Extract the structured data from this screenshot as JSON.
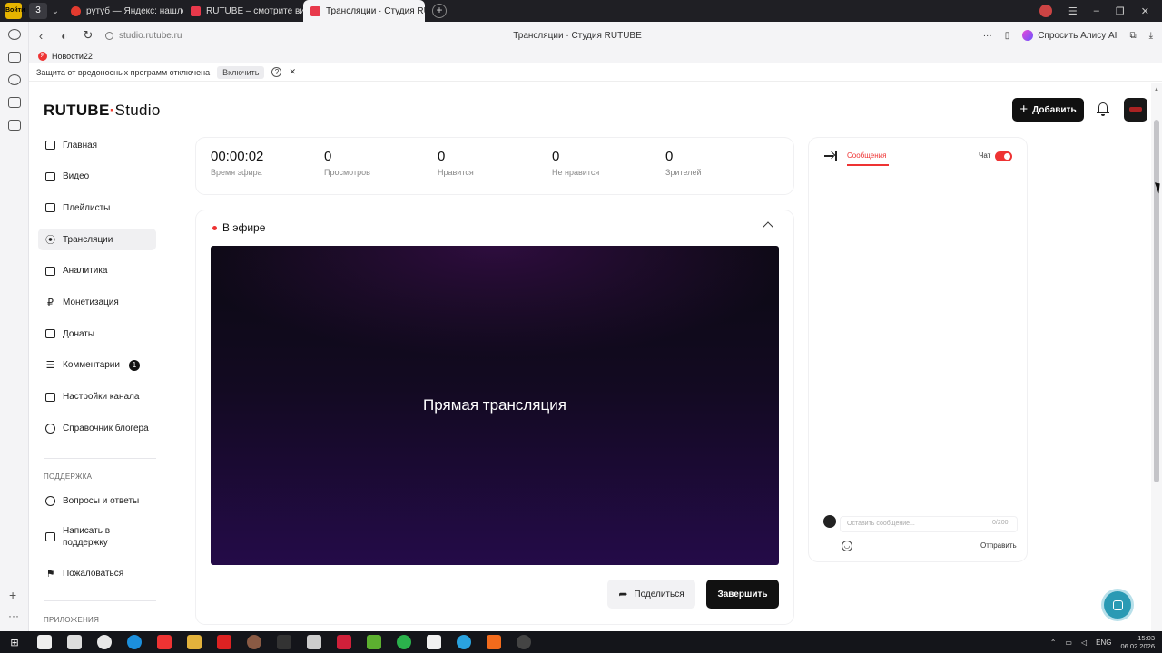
{
  "browser": {
    "tab_counter": "3",
    "logo_text": "Войти",
    "tabs": [
      {
        "label": "рутуб — Яндекс: нашлось",
        "color": "#e33b2f"
      },
      {
        "label": "RUTUBE – смотрите видео",
        "color": "#e8394b"
      },
      {
        "label": "Трансляции · Студия RUTUBE",
        "color": "#e8394b"
      }
    ],
    "url": "studio.rutube.ru",
    "page_title": "Трансляции · Студия RUTUBE",
    "alice_label": "Спросить Алису AI",
    "bookmark": "Новости22",
    "protection_text": "Защита от вредоносных программ отключена",
    "protection_enable": "Включить"
  },
  "header": {
    "logo_main": "RUTUBE",
    "logo_studio": "Studio",
    "add_label": "Добавить"
  },
  "sidebar": {
    "items": [
      {
        "label": "Главная",
        "icon": "home-icon"
      },
      {
        "label": "Видео",
        "icon": "video-icon"
      },
      {
        "label": "Плейлисты",
        "icon": "playlist-icon"
      },
      {
        "label": "Трансляции",
        "icon": "broadcast-icon"
      },
      {
        "label": "Аналитика",
        "icon": "analytics-icon"
      },
      {
        "label": "Монетизация",
        "icon": "ruble-icon"
      },
      {
        "label": "Донаты",
        "icon": "donate-icon"
      },
      {
        "label": "Комментарии",
        "icon": "comment-icon",
        "badge": "1"
      },
      {
        "label": "Настройки канала",
        "icon": "settings-icon"
      },
      {
        "label": "Справочник блогера",
        "icon": "help-book-icon"
      }
    ],
    "support_title": "ПОДДЕРЖКА",
    "support_items": [
      {
        "label": "Вопросы и ответы"
      },
      {
        "label": "Написать в поддержку"
      },
      {
        "label": "Пожаловаться"
      }
    ],
    "apps_title": "ПРИЛОЖЕНИЯ"
  },
  "stats": [
    {
      "value": "00:00:02",
      "label": "Время эфира"
    },
    {
      "value": "0",
      "label": "Просмотров"
    },
    {
      "value": "0",
      "label": "Нравится"
    },
    {
      "value": "0",
      "label": "Не нравится"
    },
    {
      "value": "0",
      "label": "Зрителей"
    }
  ],
  "air": {
    "title": "В эфире",
    "player_text": "Прямая трансляция",
    "share_label": "Поделиться",
    "finish_label": "Завершить"
  },
  "chat": {
    "tab_label": "Сообщения",
    "toggle_label": "Чат",
    "toggle_on": true,
    "input_placeholder": "Оставить сообщение...",
    "char_count": "0/200",
    "send_label": "Отправить"
  },
  "taskbar": {
    "lang": "ENG",
    "time": "15:03",
    "date": "06.02.2026"
  },
  "colors": {
    "accent": "#ee3f33",
    "dark": "#111111",
    "helper": "#2a9ab4"
  }
}
